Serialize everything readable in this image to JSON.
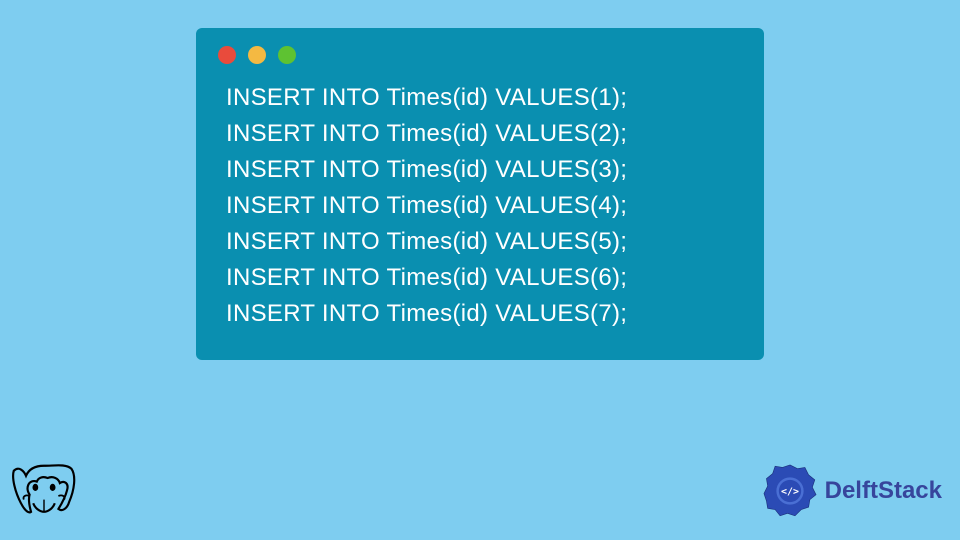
{
  "code": {
    "lines": [
      "INSERT INTO Times(id) VALUES(1);",
      "INSERT INTO Times(id) VALUES(2);",
      "INSERT INTO Times(id) VALUES(3);",
      "INSERT INTO Times(id) VALUES(4);",
      "INSERT INTO Times(id) VALUES(5);",
      "INSERT INTO Times(id) VALUES(6);",
      "INSERT INTO Times(id) VALUES(7);"
    ]
  },
  "branding": {
    "delftstack_label": "DelftStack"
  },
  "colors": {
    "background": "#7ecdf0",
    "window": "#0a8fb0",
    "text": "#ffffff",
    "brand": "#37459c"
  }
}
